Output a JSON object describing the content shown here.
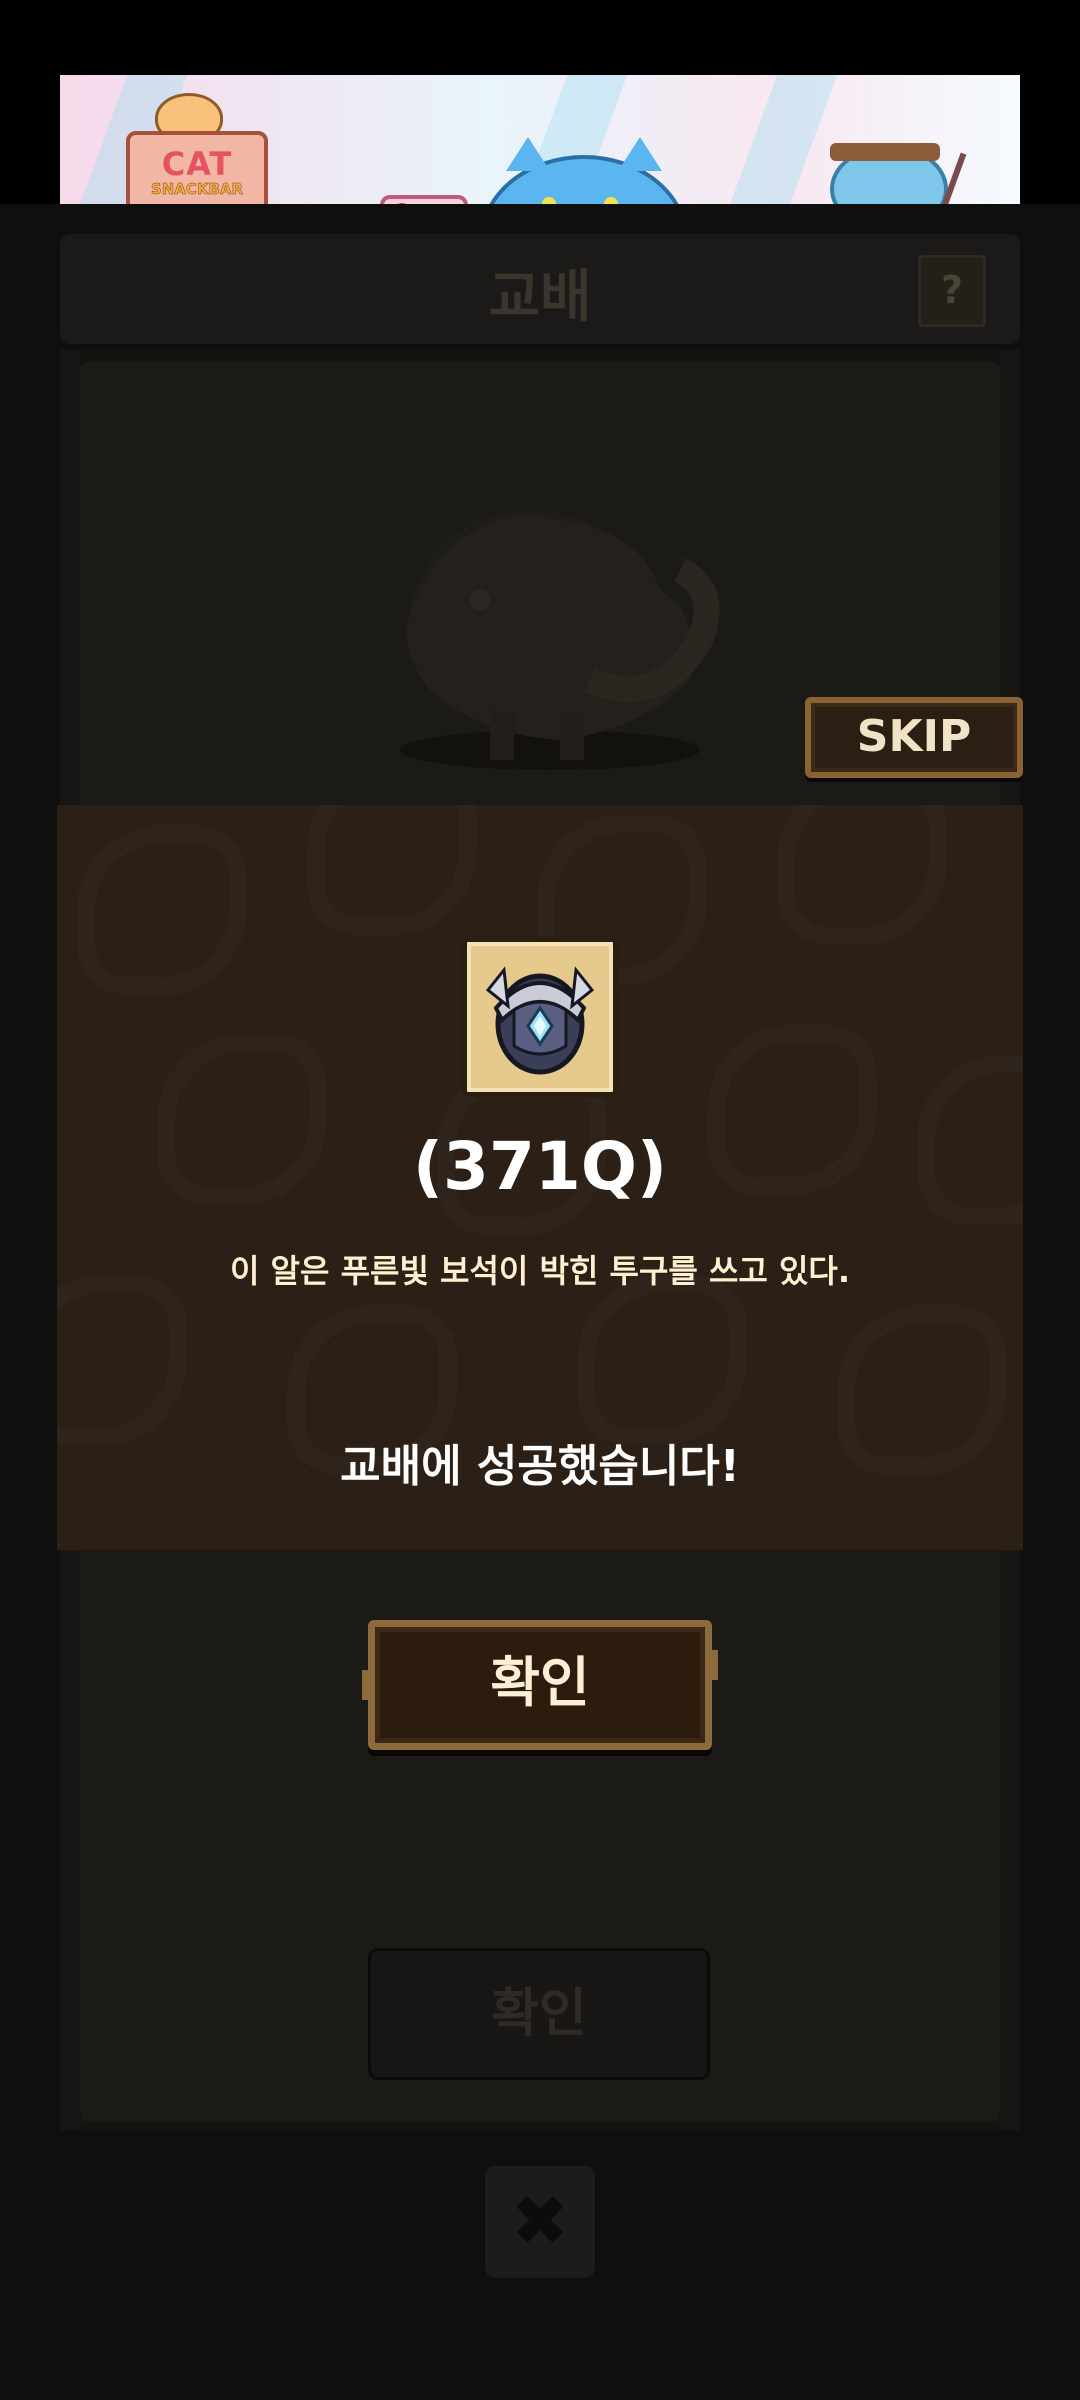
{
  "ad": {
    "logo_line1": "CAT",
    "logo_line2": "SNACKBAR"
  },
  "screen": {
    "title": "교배",
    "help_label": "?",
    "skip_label": "SKIP",
    "confirm_behind_label": "확인",
    "close_label": "✖"
  },
  "dialog": {
    "item_name": "(371Q)",
    "item_description": "이 알은 푸른빛 보석이 박힌 투구를 쓰고 있다.",
    "message": "교배에 성공했습니다!",
    "confirm_label": "확인"
  },
  "colors": {
    "dialog_bg": "#2b1f16",
    "button_border": "#8d6a3c",
    "item_frame": "#e6c98d"
  }
}
